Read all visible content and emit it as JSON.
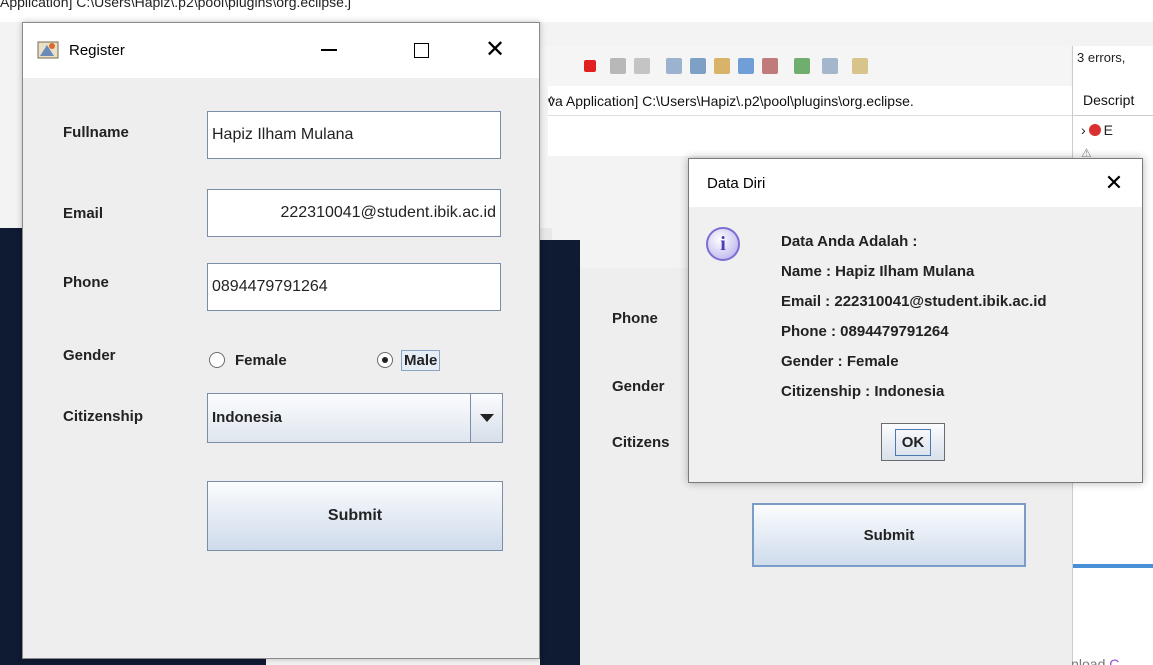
{
  "background": {
    "path_text": "Application] C:\\Users\\Hapiz\\.p2\\pool\\plugins\\org.eclipse.j",
    "console_text": "va Application] C:\\Users\\Hapiz\\.p2\\pool\\plugins\\org.eclipse.",
    "errors_text": "3 errors,",
    "tab_label": "Descript",
    "row1_text": "E",
    "mid_tab_text": "a",
    "download_prefix": "wnload ",
    "download_link": "C",
    "reg2": {
      "phone_label": "Phone",
      "gender_label": "Gender",
      "citizenship_label": "Citizens",
      "submit_label": "Submit"
    }
  },
  "register": {
    "title": "Register",
    "fields": {
      "fullname_label": "Fullname",
      "fullname_value": "Hapiz Ilham Mulana",
      "email_label": "Email",
      "email_value": "222310041@student.ibik.ac.id",
      "phone_label": "Phone",
      "phone_value": "0894479791264",
      "gender_label": "Gender",
      "gender_female": "Female",
      "gender_male": "Male",
      "citizenship_label": "Citizenship",
      "citizenship_value": "Indonesia"
    },
    "submit_label": "Submit"
  },
  "dialog": {
    "title": "Data Diri",
    "lines": [
      "Data Anda Adalah :",
      "Name : Hapiz Ilham Mulana",
      "Email : 222310041@student.ibik.ac.id",
      "Phone : 0894479791264",
      "Gender : Female",
      "Citizenship : Indonesia"
    ],
    "ok_label": "OK"
  }
}
